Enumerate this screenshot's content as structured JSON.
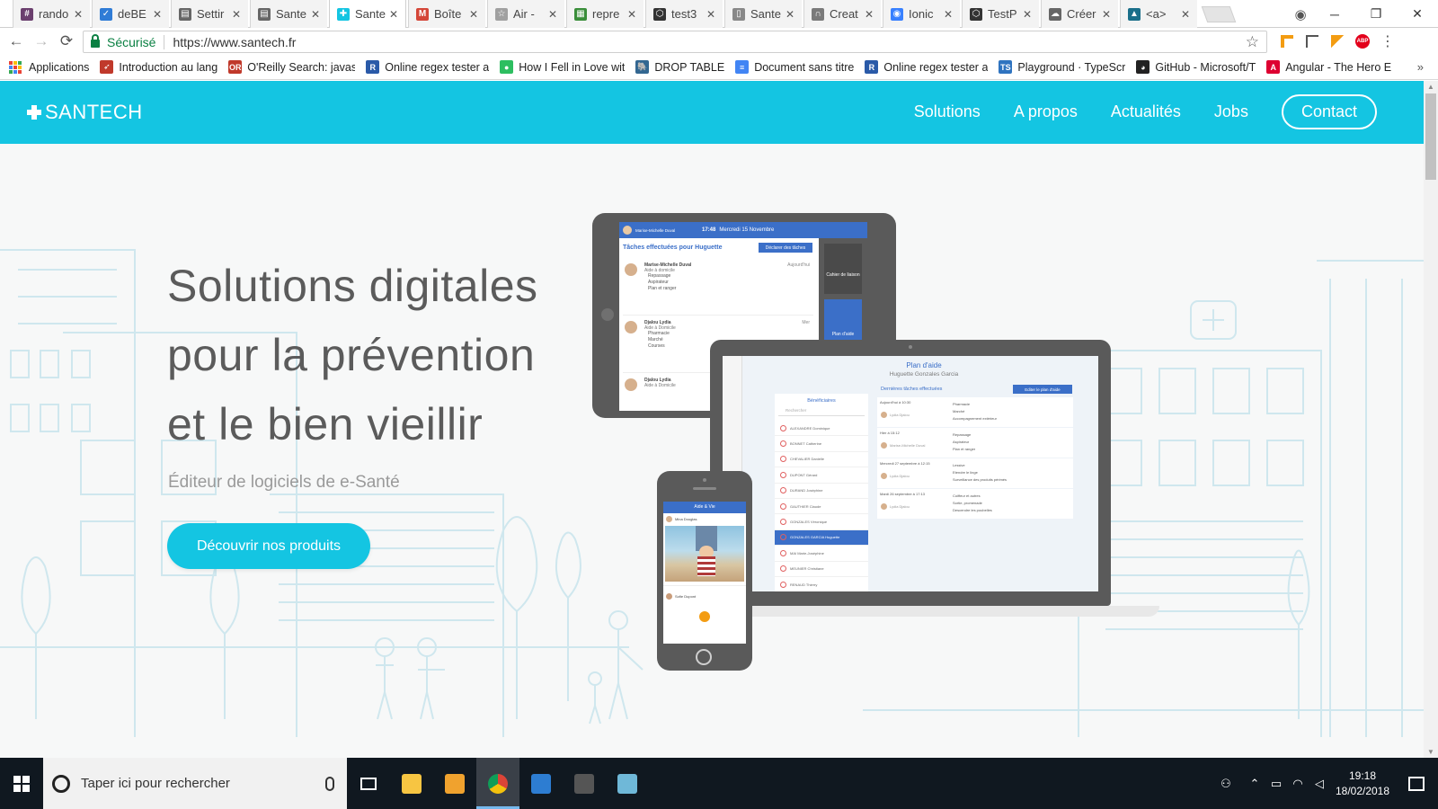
{
  "browser": {
    "tabs": [
      {
        "title": "rando",
        "icon": "slack-icon",
        "color": "#6b3f6e",
        "glyph": "#"
      },
      {
        "title": "deBE",
        "icon": "trello-icon",
        "color": "#2f7cd6",
        "glyph": "✓"
      },
      {
        "title": "Settir",
        "icon": "document-icon",
        "color": "#666666",
        "glyph": "▤"
      },
      {
        "title": "Sante",
        "icon": "document-icon",
        "color": "#666666",
        "glyph": "▤"
      },
      {
        "title": "Sante",
        "icon": "santech-cross-icon",
        "color": "#14c5e2",
        "glyph": "✚",
        "active": true
      },
      {
        "title": "Boîte",
        "icon": "gmail-icon",
        "color": "#d44638",
        "glyph": "M"
      },
      {
        "title": "Air -",
        "icon": "star-outline-icon",
        "color": "#a0a0a0",
        "glyph": "☆"
      },
      {
        "title": "repre",
        "icon": "spreadsheet-icon",
        "color": "#3a8e3a",
        "glyph": "▦"
      },
      {
        "title": "test3",
        "icon": "codepen-icon",
        "color": "#333333",
        "glyph": "⬡"
      },
      {
        "title": "Sante",
        "icon": "page-icon",
        "color": "#888888",
        "glyph": "▯"
      },
      {
        "title": "Creat",
        "icon": "headset-icon",
        "color": "#7a7a7a",
        "glyph": "∩"
      },
      {
        "title": "Ionic",
        "icon": "ionic-icon",
        "color": "#3880ff",
        "glyph": "◉"
      },
      {
        "title": "TestP",
        "icon": "codepen-icon",
        "color": "#333333",
        "glyph": "⬡"
      },
      {
        "title": "Créer",
        "icon": "cloud-icon",
        "color": "#666666",
        "glyph": "☁"
      },
      {
        "title": "<a>",
        "icon": "graduation-icon",
        "color": "#1a6f8a",
        "glyph": "▲"
      }
    ],
    "tab_close": "✕",
    "secure_label": "Sécurisé",
    "url": "https://www.santech.fr",
    "bookmarks": [
      {
        "label": "Applications",
        "icon": "apps-grid-icon",
        "color": "#444444",
        "glyph": ""
      },
      {
        "label": "Introduction au lang",
        "icon": "rocket-icon",
        "color": "#c0392b",
        "glyph": "➶"
      },
      {
        "label": "O'Reilly Search: javas",
        "icon": "oreilly-icon",
        "color": "#c0392b",
        "glyph": "OR"
      },
      {
        "label": "Online regex tester a",
        "icon": "regex-icon",
        "color": "#2a5aa8",
        "glyph": "R"
      },
      {
        "label": "How I Fell in Love wit",
        "icon": "medium-icon",
        "color": "#2dbe60",
        "glyph": "●"
      },
      {
        "label": "DROP TABLE",
        "icon": "elephant-icon",
        "color": "#336791",
        "glyph": "🐘"
      },
      {
        "label": "Document sans titre",
        "icon": "google-docs-icon",
        "color": "#4285f4",
        "glyph": "≡"
      },
      {
        "label": "Online regex tester a",
        "icon": "regex-icon",
        "color": "#2a5aa8",
        "glyph": "R"
      },
      {
        "label": "Playground · TypeScr",
        "icon": "typescript-icon",
        "color": "#2f74c0",
        "glyph": "TS"
      },
      {
        "label": "GitHub - Microsoft/T",
        "icon": "github-icon",
        "color": "#222222",
        "glyph": "◕"
      },
      {
        "label": "Angular - The Hero E",
        "icon": "angular-icon",
        "color": "#dd0031",
        "glyph": "A"
      }
    ]
  },
  "site": {
    "brand": "SANTECH",
    "menu": [
      "Solutions",
      "A propos",
      "Actualités",
      "Jobs"
    ],
    "contact": "Contact",
    "hero_title": [
      "Solutions digitales",
      "pour la prévention",
      "et le bien vieillir"
    ],
    "hero_subtitle": "Éditeur de logiciels de e-Santé",
    "cta": "Découvrir nos produits",
    "tablet": {
      "header_name": "Marise-Michelle Duval",
      "header_time": "17:48",
      "header_date": "Mercredi 15 Novembre",
      "section_title": "Tâches effectuées pour Huguette",
      "declare_button": "Déclarer des tâches",
      "entries": [
        {
          "name": "Marise-Michelle Duval",
          "role": "Aide à domicile",
          "when": "Aujourd'hui",
          "tasks": [
            "Repassage",
            "Aspirateur",
            "Plan et ranger"
          ]
        },
        {
          "name": "Djalou Lydia",
          "role": "Aide à Domicile",
          "when": "Mer",
          "tasks": [
            "Pharmacie",
            "Marché",
            "Courses"
          ]
        },
        {
          "name": "Djalou Lydia",
          "role": "Aide à Domicile",
          "when": "",
          "tasks": []
        }
      ],
      "side_buttons": [
        "Cahier de liaison",
        "Plan d'aide"
      ]
    },
    "laptop": {
      "title": "Plan d'aide",
      "person": "Huguette Gonzales Garcia",
      "list_title": "Bénéficiaires",
      "search_placeholder": "Rechercher",
      "beneficiaries": [
        "ALEXANDRE Dominique",
        "BONNET Catherine",
        "CHEVALIER Danielle",
        "DUPONT Gérard",
        "DURAND Joséphine",
        "GAUTHIER Claude",
        "GONZALES Véronique",
        "GONZALES GARCIA Huguette",
        "MAI Marie-Joséphine",
        "MEUNIER Christiane",
        "RENAUD Thierry"
      ],
      "selected_index": 7,
      "recent_title": "Dernières tâches effectuées",
      "edit_button": "Editer le plan d'aide",
      "rows": [
        {
          "date": "Aujourd'hui à 10:30",
          "name": "Lydia Djalou",
          "tasks": [
            "Pharmacie",
            "Marché",
            "Accompagnement extérieur"
          ]
        },
        {
          "date": "Hier à 15:12",
          "name": "Marise-Michelle Duval",
          "tasks": [
            "Repassage",
            "Aspirateur",
            "Plan et ranger"
          ]
        },
        {
          "date": "Mercredi 27 septembre à 12:15",
          "name": "Lydia Djalou",
          "tasks": [
            "Lessive",
            "Etendre le linge",
            "Surveillance des produits périmés"
          ]
        },
        {
          "date": "Mardi 26 septembre à 17:13",
          "name": "Lydia Djalou",
          "tasks": [
            "Coiffeur et autres",
            "Sortie, promenade",
            "Descendre les poubelles"
          ]
        }
      ]
    },
    "phone": {
      "header": "Aide & Vie",
      "post_author": "Mina Douglas",
      "reply_author": "Sofie Dupont"
    }
  },
  "taskbar": {
    "search_placeholder": "Taper ici pour rechercher",
    "apps": [
      {
        "name": "file-explorer",
        "icon": "folder-icon",
        "color": "#f7c542"
      },
      {
        "name": "git",
        "icon": "git-icon",
        "color": "#f0a22e"
      },
      {
        "name": "chrome",
        "icon": "chrome-icon",
        "color": "#db4437",
        "active": true
      },
      {
        "name": "vscode",
        "icon": "vscode-icon",
        "color": "#2d7dd2"
      },
      {
        "name": "terminal",
        "icon": "terminal-icon",
        "color": "#555555"
      },
      {
        "name": "notepad",
        "icon": "notepad-icon",
        "color": "#6fb8d8"
      }
    ],
    "time": "19:18",
    "date": "18/02/2018"
  },
  "colors": {
    "brand": "#14c5e2",
    "text_dark": "#5b5b5b",
    "secure": "#0b8043"
  }
}
